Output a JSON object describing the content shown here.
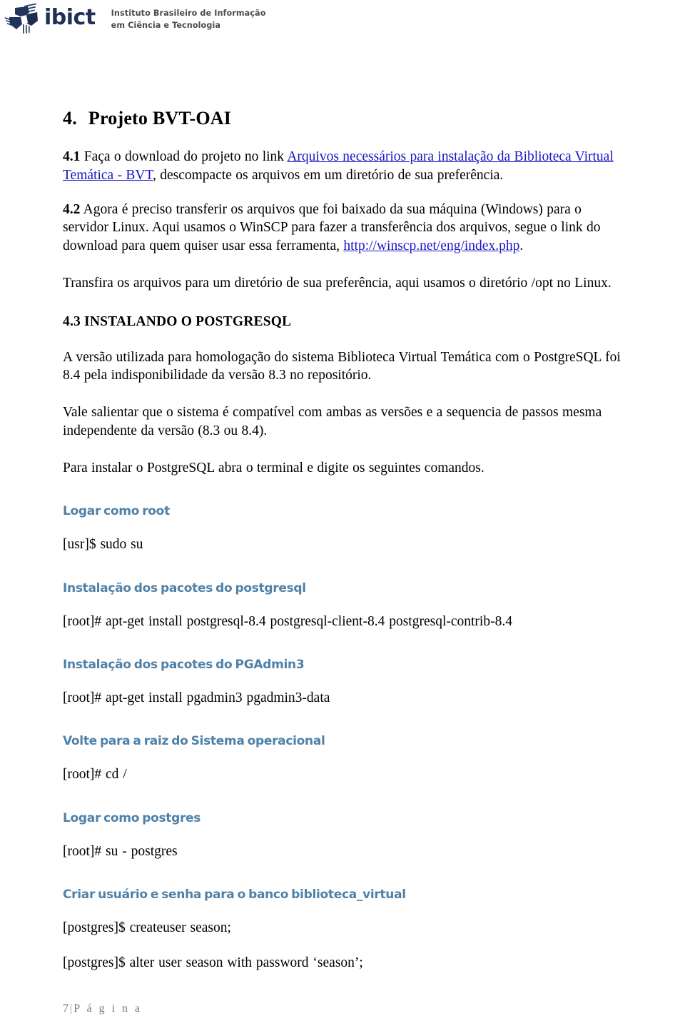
{
  "header": {
    "logo_word": "ibict",
    "logo_icon_name": "ibict-pinwheel-logo",
    "tagline_line1": "Instituto Brasileiro de Informação",
    "tagline_line2": "em Ciência e Tecnologia",
    "logo_color": "#1f2f56",
    "tagline_color": "#4a4a4a"
  },
  "document": {
    "title_number": "4.",
    "title_text": "Projeto BVT-OAI",
    "item_41": {
      "number": "4.1",
      "text_before_link": " Faça o download do projeto no link ",
      "link_text": "Arquivos necessários para instalação da Biblioteca Virtual Temática - BVT",
      "text_after_link": ", descompacte os arquivos em um diretório de sua preferência."
    },
    "item_42": {
      "number": "4.2",
      "text_before_link": " Agora é preciso transferir os arquivos que foi baixado da sua máquina (Windows) para o servidor Linux. Aqui usamos o WinSCP para fazer a transferência dos arquivos, segue o link do download para quem quiser usar essa ferramenta, ",
      "link_text": "http://winscp.net/eng/index.php",
      "text_after_link": "."
    },
    "paragraph_transfira": "Transfira os arquivos para um diretório de sua preferência, aqui usamos o diretório /opt no Linux.",
    "heading_43": "4.3 INSTALANDO O POSTGRESQL",
    "paragraph_versao": "A versão utilizada  para homologação do sistema  Biblioteca  Virtual Temática com  o PostgreSQL foi 8.4 pela indisponibilidade  da versão 8.3 no repositório.",
    "paragraph_vale": "Vale salientar  que o sistema  é compatível  com ambas as versões e a sequencia de passos mesma independente da versão (8.3 ou 8.4).",
    "paragraph_para_instalar": "Para instalar o PostgreSQL abra o terminal e digite os seguintes comandos.",
    "sections": [
      {
        "heading": "Logar como root",
        "command": "[usr]$ sudo su"
      },
      {
        "heading": "Instalação dos pacotes do postgresql",
        "command": "[root]# apt-get install postgresql-8.4 postgresql-client-8.4 postgresql-contrib-8.4"
      },
      {
        "heading": "Instalação dos pacotes do PGAdmin3",
        "command": "[root]# apt-get install pgadmin3  pgadmin3-data"
      },
      {
        "heading": "Volte para a raiz do Sistema operacional",
        "command": "[root]# cd /"
      },
      {
        "heading": "Logar como postgres",
        "command": "[root]# su - postgres"
      },
      {
        "heading": "Criar usuário e senha para o banco biblioteca_virtual",
        "command": "[postgres]$ createuser  season;",
        "command2": "[postgres]$ alter user season with  password ‘season’;"
      }
    ],
    "heading_color": "#4f81a8",
    "link_color": "#1a16c4"
  },
  "footer": {
    "page_number": "7",
    "separator": "|",
    "label": "P á g i n a"
  }
}
